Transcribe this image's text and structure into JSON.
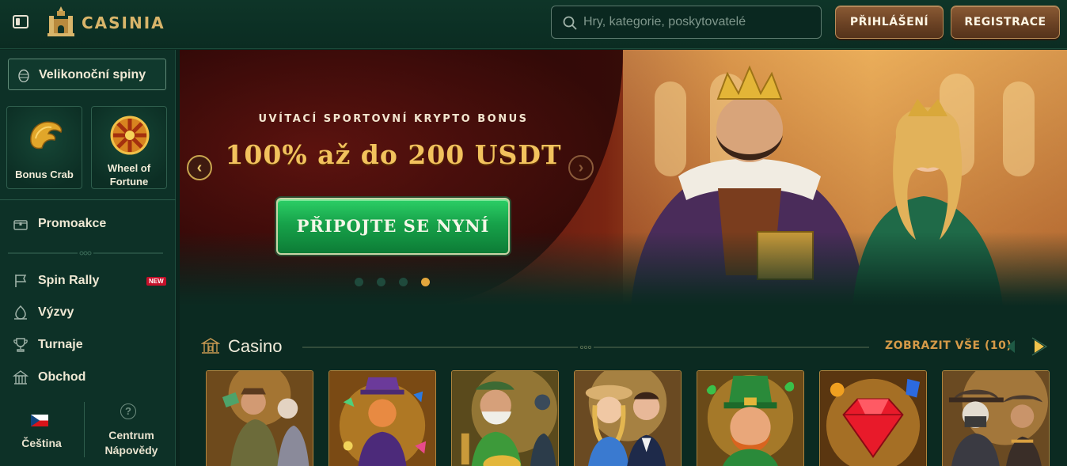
{
  "header": {
    "logo_text": "CASINIA",
    "search_placeholder": "Hry, kategorie, poskytovatelé",
    "login_label": "PŘIHLÁŠENÍ",
    "register_label": "REGISTRACE"
  },
  "sidebar": {
    "easter": "Velikonoční spiny",
    "tiles": [
      {
        "label": "Bonus Crab",
        "icon": "claw-icon"
      },
      {
        "label_line1": "Wheel of",
        "label_line2": "Fortune",
        "icon": "wheel-icon"
      }
    ],
    "promo": "Promoakce",
    "items": [
      {
        "label": "Spin Rally",
        "icon": "flag-icon",
        "badge": "NEW"
      },
      {
        "label": "Výzvy",
        "icon": "challenge-icon"
      },
      {
        "label": "Turnaje",
        "icon": "trophy-icon"
      },
      {
        "label": "Obchod",
        "icon": "shop-icon"
      }
    ],
    "language": "Čeština",
    "help_line1": "Centrum",
    "help_line2": "Nápovědy"
  },
  "hero": {
    "subtitle": "UVÍTACÍ SPORTOVNÍ KRYPTO BONUS",
    "title": "100% až do 200 USDT",
    "cta": "PŘIPOJTE SE NYNÍ",
    "slides": 4,
    "active_slide": 4
  },
  "casino": {
    "title": "Casino",
    "view_all": "ZOBRAZIT VŠE (10)",
    "games": [
      {
        "name": "game-card-1",
        "theme": "explorer"
      },
      {
        "name": "game-card-2",
        "theme": "gems"
      },
      {
        "name": "game-card-3",
        "theme": "fisherman"
      },
      {
        "name": "game-card-4",
        "theme": "couple"
      },
      {
        "name": "game-card-5",
        "theme": "leprechaun"
      },
      {
        "name": "game-card-6",
        "theme": "diamond"
      },
      {
        "name": "game-card-7",
        "theme": "outlaws"
      }
    ]
  },
  "colors": {
    "bg": "#0b2a21",
    "gold": "#d9b56a",
    "accent_orange": "#d59a48",
    "cta_green": "#17a24a",
    "badge_red": "#c5102a"
  }
}
